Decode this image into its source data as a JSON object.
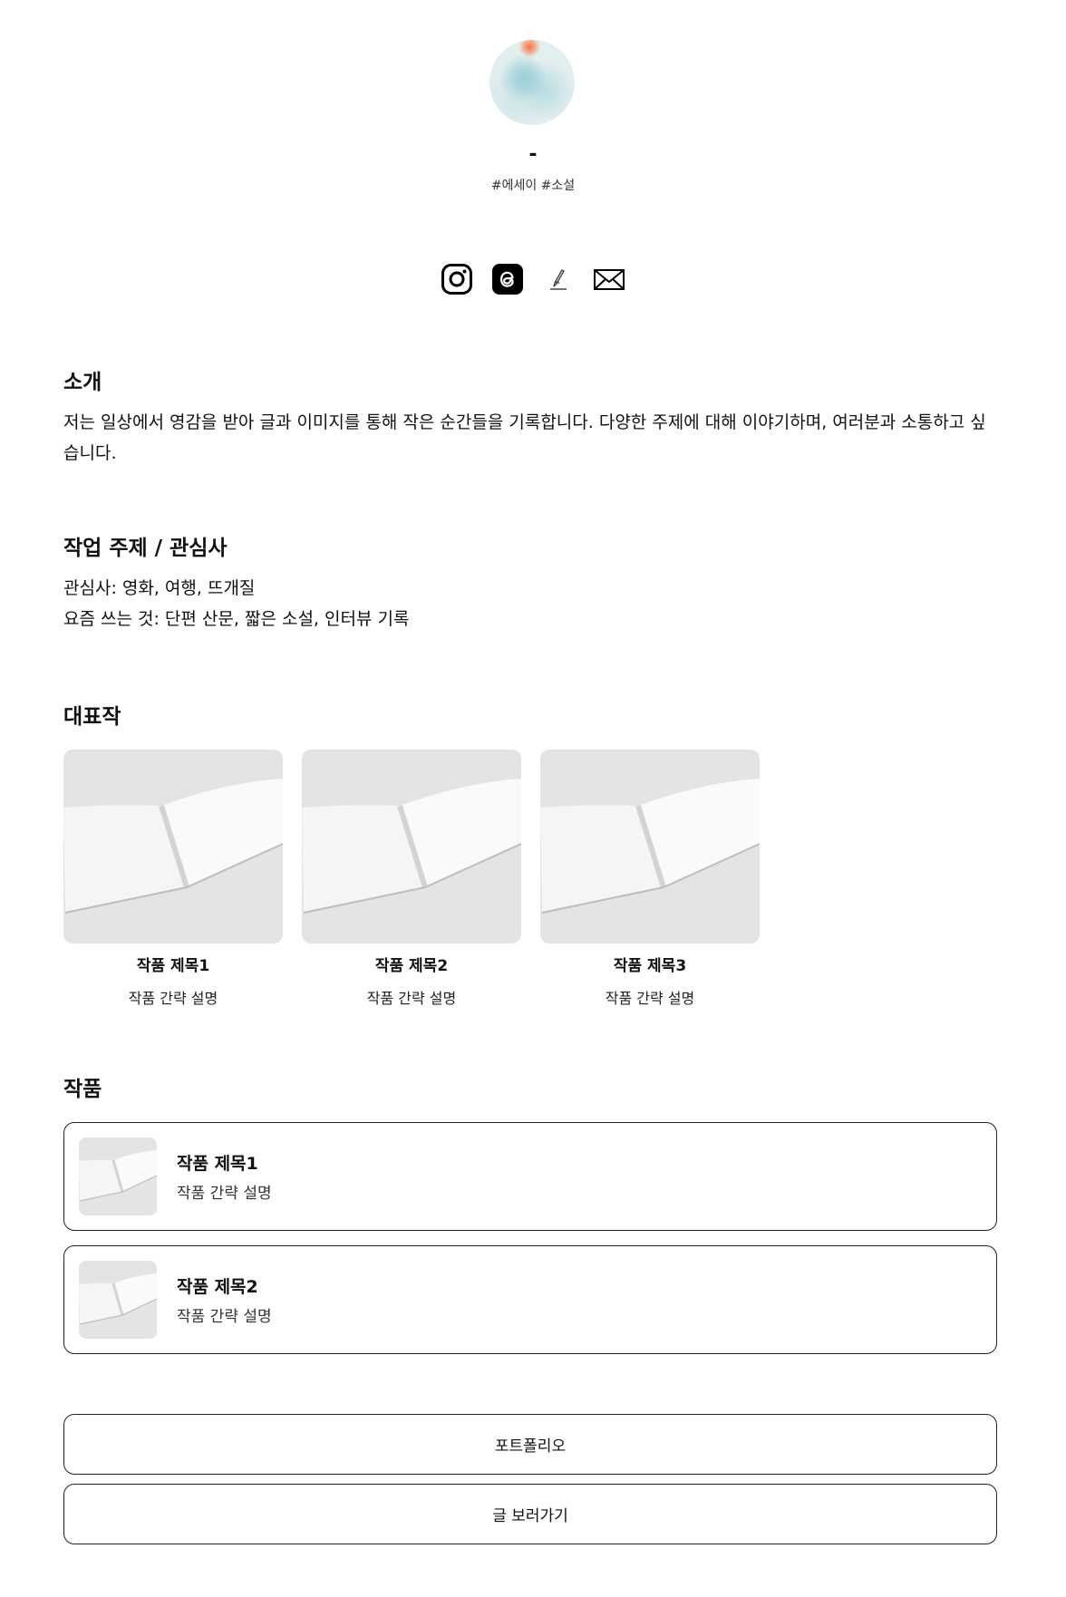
{
  "profile": {
    "name": "-",
    "tags": "#에세이 #소설"
  },
  "social_links": [
    {
      "icon": "instagram-icon"
    },
    {
      "icon": "threads-icon"
    },
    {
      "icon": "pen-icon"
    },
    {
      "icon": "mail-icon"
    }
  ],
  "intro": {
    "title": "소개",
    "text": "저는 일상에서 영감을 받아 글과 이미지를 통해 작은 순간들을 기록합니다. 다양한 주제에 대해 이야기하며, 여러분과 소통하고 싶습니다."
  },
  "topics": {
    "title": "작업 주제 / 관심사",
    "line1": "관심사: 영화, 여행, 뜨개질",
    "line2": "요즘 쓰는 것: 단편 산문, 짧은 소설, 인터뷰 기록"
  },
  "featured": {
    "title": "대표작",
    "items": [
      {
        "title": "작품 제목1",
        "desc": "작품 간략 설명"
      },
      {
        "title": "작품 제목2",
        "desc": "작품 간략 설명"
      },
      {
        "title": "작품 제목3",
        "desc": "작품 간략 설명"
      }
    ]
  },
  "works": {
    "title": "작품",
    "items": [
      {
        "title": "작품 제목1",
        "desc": "작품 간략 설명"
      },
      {
        "title": "작품 제목2",
        "desc": "작품 간략 설명"
      }
    ]
  },
  "buttons": {
    "portfolio": "포트폴리오",
    "view_posts": "글 보러가기"
  },
  "colors": {
    "text": "#111111",
    "border": "#222222",
    "thumb_bg": "#e4e4e4"
  }
}
